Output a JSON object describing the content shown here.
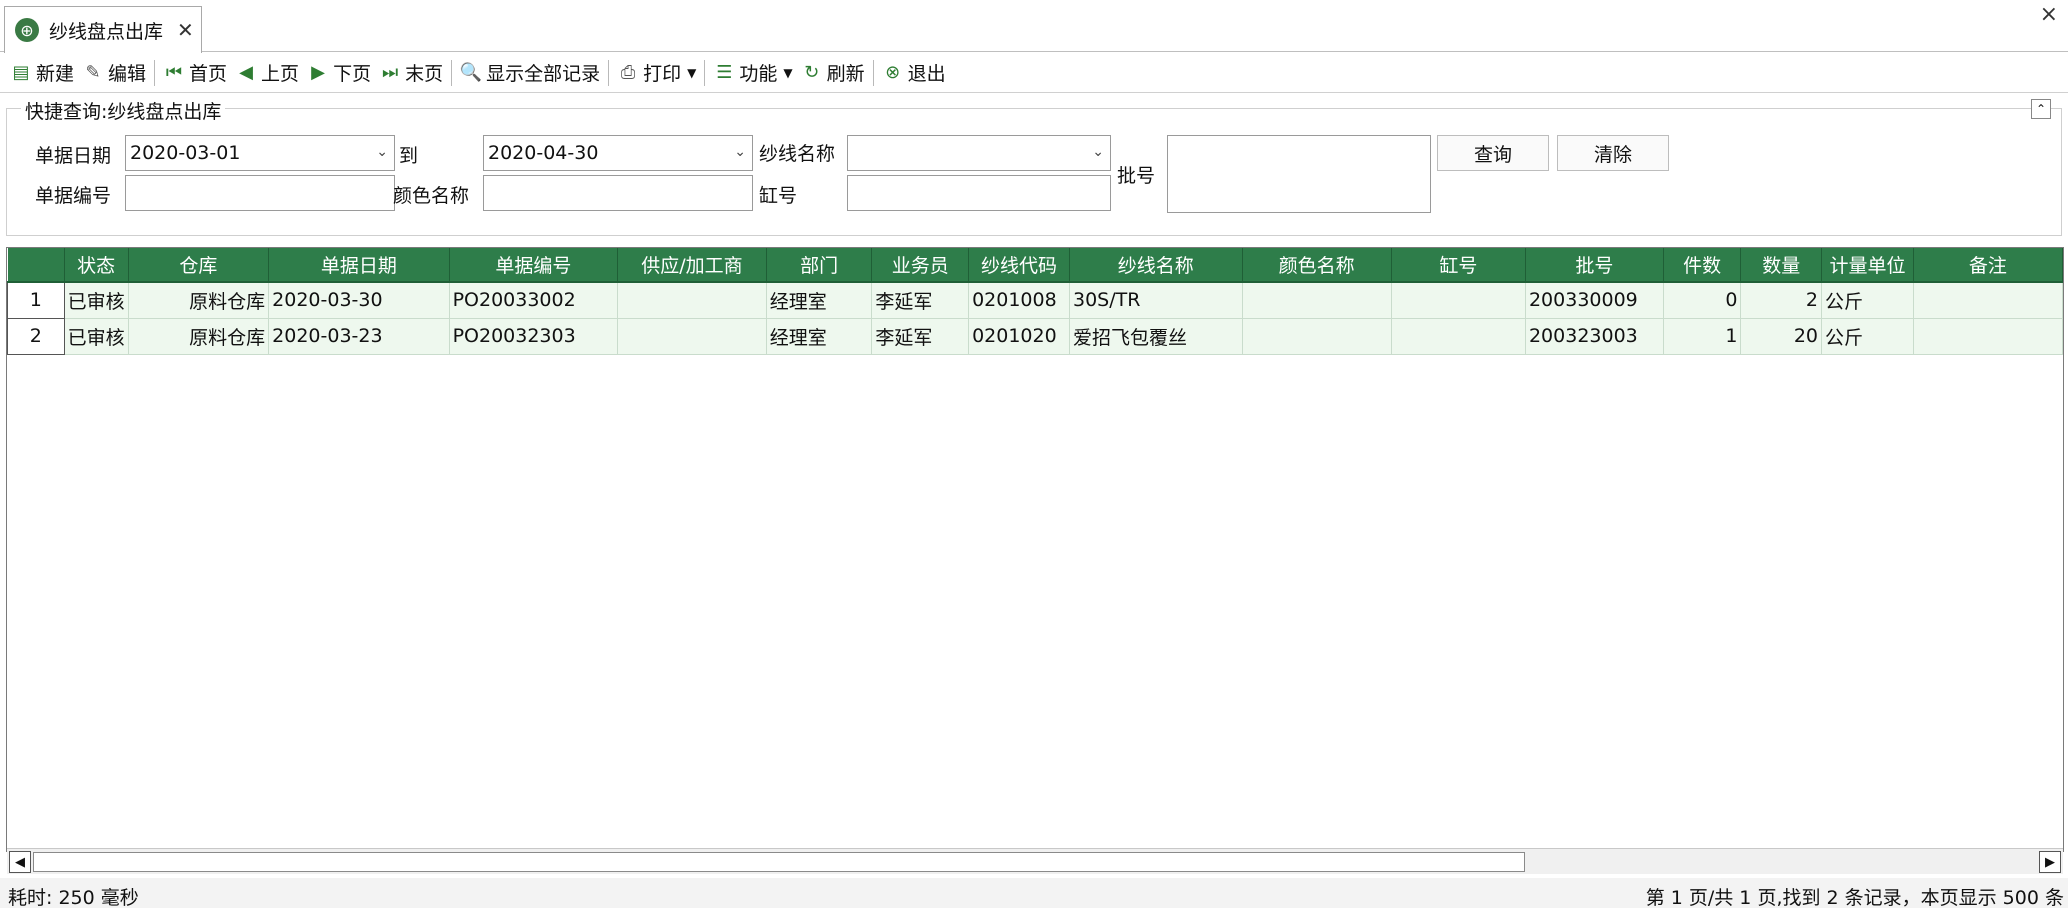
{
  "tab": {
    "title": "纱线盘点出库",
    "close": "✕"
  },
  "window": {
    "close": "×"
  },
  "toolbar": {
    "new": "新建",
    "edit": "编辑",
    "first": "首页",
    "prev": "上页",
    "next": "下页",
    "last": "末页",
    "show_all": "显示全部记录",
    "print": "打印",
    "functions": "功能",
    "refresh": "刷新",
    "exit": "退出"
  },
  "query": {
    "title": "快捷查询:纱线盘点出库",
    "date_label": "单据日期",
    "date_from": "2020-03-01",
    "to_label": "到",
    "date_to": "2020-04-30",
    "yarn_name_label": "纱线名称",
    "yarn_name_value": "",
    "doc_no_label": "单据编号",
    "doc_no_value": "",
    "color_label": "颜色名称",
    "color_value": "",
    "vat_label": "缸号",
    "vat_value": "",
    "batch_label": "批号",
    "batch_value": "",
    "search_btn": "查询",
    "clear_btn": "清除"
  },
  "grid": {
    "columns": [
      "",
      "状态",
      "仓库",
      "单据日期",
      "单据编号",
      "供应/加工商",
      "部门",
      "业务员",
      "纱线代码",
      "纱线名称",
      "颜色名称",
      "缸号",
      "批号",
      "件数",
      "数量",
      "计量单位",
      "备注"
    ],
    "rows": [
      [
        "1",
        "已审核",
        "原料仓库",
        "2020-03-30",
        "PO20033002",
        "",
        "经理室",
        "李延军",
        "0201008",
        "30S/TR",
        "",
        "",
        "200330009",
        "0",
        "2",
        "公斤",
        ""
      ],
      [
        "2",
        "已审核",
        "原料仓库",
        "2020-03-23",
        "PO20032303",
        "",
        "经理室",
        "李延军",
        "0201020",
        "爱招飞包覆丝",
        "",
        "",
        "200323003",
        "1",
        "20",
        "公斤",
        ""
      ]
    ]
  },
  "status": {
    "elapsed": "耗时: 250 毫秒",
    "paging": "第 1 页/共 1 页,找到 2 条记录，本页显示 500 条"
  },
  "colors": {
    "header_bg": "#2e7d4a",
    "row_bg": "#eef8ee",
    "icon_green": "#2e7d32"
  }
}
